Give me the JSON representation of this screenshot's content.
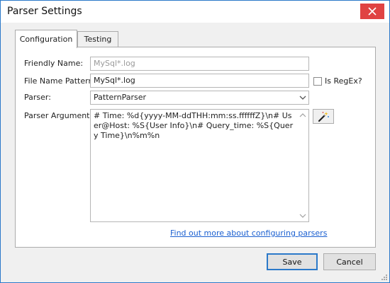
{
  "window": {
    "title": "Parser Settings"
  },
  "tabs": [
    {
      "label": "Configuration",
      "active": true
    },
    {
      "label": "Testing",
      "active": false
    }
  ],
  "form": {
    "friendly_name": {
      "label": "Friendly Name:",
      "placeholder": "MySql*.log"
    },
    "file_name_pattern": {
      "label": "File Name Pattern:",
      "value": "MySql*.log"
    },
    "is_regex": {
      "label": "Is RegEx?",
      "checked": false
    },
    "parser": {
      "label": "Parser:",
      "value": "PatternParser"
    },
    "parser_arguments": {
      "label": "Parser Arguments:",
      "value": "# Time: %d{yyyy-MM-ddTHH:mm:ss.ffffffZ}\\n# User@Host: %S{User Info}\\n# Query_time: %S{Query Time}\\n%m%n"
    }
  },
  "link": {
    "text": "Find out more about configuring parsers"
  },
  "buttons": {
    "save": "Save",
    "cancel": "Cancel"
  },
  "icons": {
    "close": "close-icon",
    "dropdown": "chevron-down-icon",
    "wand": "magic-wand-icon",
    "scroll_up": "scroll-up-icon",
    "scroll_down": "scroll-down-icon",
    "grip": "resize-grip-icon"
  },
  "colors": {
    "accent": "#2b79c9",
    "close_red": "#e04343",
    "link": "#1a5fd0"
  }
}
